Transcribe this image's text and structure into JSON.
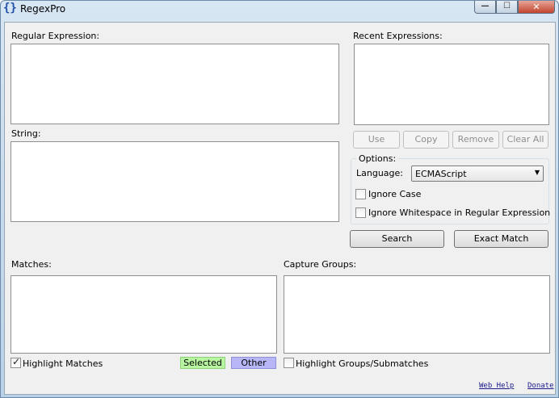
{
  "window": {
    "title": "RegexPro",
    "app_icon": "{}"
  },
  "caption_buttons": {
    "minimize": "—",
    "maximize": "☐",
    "close": "✕"
  },
  "labels": {
    "regular_expression": "Regular Expression:",
    "recent_expressions": "Recent Expressions:",
    "string": "String:",
    "matches": "Matches:",
    "capture_groups": "Capture Groups:"
  },
  "recent_buttons": {
    "use": "Use",
    "copy": "Copy",
    "remove": "Remove",
    "clear_all": "Clear All"
  },
  "options": {
    "title": "Options:",
    "language_label": "Language:",
    "language_value": "ECMAScript",
    "ignore_case": "Ignore Case",
    "ignore_whitespace": "Ignore Whitespace in Regular Expression"
  },
  "actions": {
    "search": "Search",
    "exact_match": "Exact Match"
  },
  "footer": {
    "highlight_matches": "Highlight Matches",
    "selected": "Selected",
    "other": "Other",
    "highlight_groups": "Highlight Groups/Submatches",
    "web_help": "Web Help",
    "donate": "Donate"
  },
  "colors": {
    "selected_swatch": "#b7f5a0",
    "other_swatch": "#b7b7f7"
  }
}
